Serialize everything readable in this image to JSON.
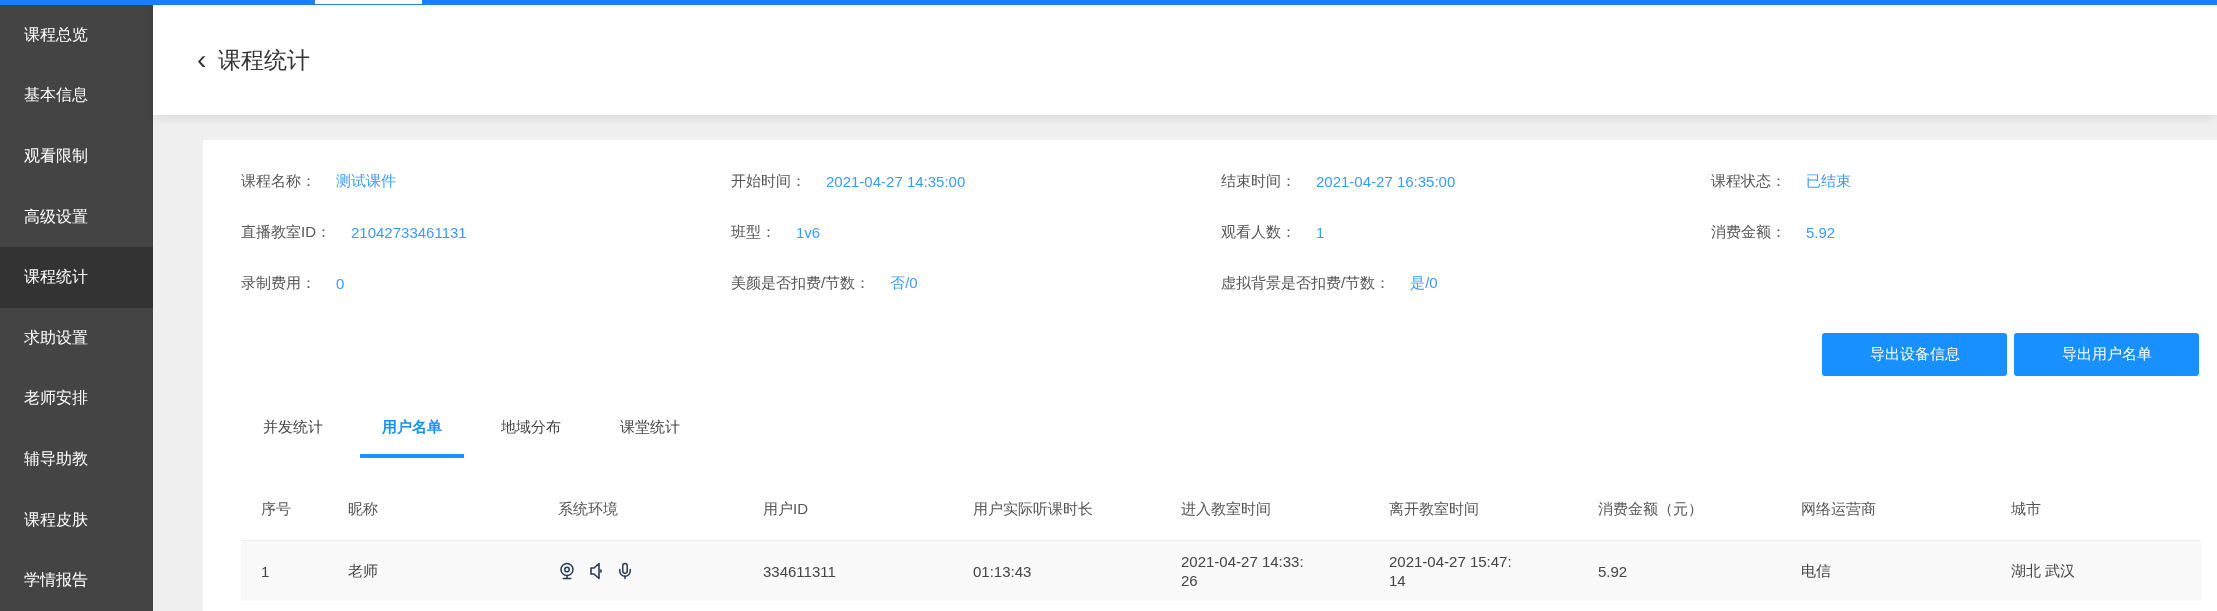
{
  "sidebar": {
    "items": [
      {
        "label": "课程总览",
        "selected": false
      },
      {
        "label": "基本信息",
        "selected": false
      },
      {
        "label": "观看限制",
        "selected": false
      },
      {
        "label": "高级设置",
        "selected": false
      },
      {
        "label": "课程统计",
        "selected": true
      },
      {
        "label": "求助设置",
        "selected": false
      },
      {
        "label": "老师安排",
        "selected": false
      },
      {
        "label": "辅导助教",
        "selected": false
      },
      {
        "label": "课程皮肤",
        "selected": false
      },
      {
        "label": "学情报告",
        "selected": false
      }
    ]
  },
  "header": {
    "back": "‹",
    "title": "课程统计"
  },
  "info": [
    {
      "label": "课程名称：",
      "value": "测试课件"
    },
    {
      "label": "开始时间：",
      "value": "2021-04-27 14:35:00"
    },
    {
      "label": "结束时间：",
      "value": "2021-04-27 16:35:00"
    },
    {
      "label": "课程状态：",
      "value": "已结束"
    },
    {
      "label": "直播教室ID：",
      "value": "21042733461131"
    },
    {
      "label": "班型：",
      "value": "1v6"
    },
    {
      "label": "观看人数：",
      "value": "1"
    },
    {
      "label": "消费金额：",
      "value": "5.92"
    },
    {
      "label": "录制费用：",
      "value": "0"
    },
    {
      "label": "美颜是否扣费/节数：",
      "value": "否/0"
    },
    {
      "label": "虚拟背景是否扣费/节数：",
      "value": "是/0"
    }
  ],
  "buttons": [
    "导出设备信息",
    "导出用户名单"
  ],
  "tabs": [
    {
      "label": "并发统计",
      "selected": false
    },
    {
      "label": "用户名单",
      "selected": true
    },
    {
      "label": "地域分布",
      "selected": false
    },
    {
      "label": "课堂统计",
      "selected": false
    }
  ],
  "table": {
    "columns": [
      "序号",
      "昵称",
      "系统环境",
      "用户ID",
      "用户实际听课时长",
      "进入教室时间",
      "离开教室时间",
      "消费金额（元）",
      "网络运营商",
      "城市"
    ],
    "rows": [
      {
        "cells": [
          "1",
          "老师",
          "",
          "334611311",
          "01:13:43",
          "2021-04-27 14:33:26",
          "2021-04-27 15:47:14",
          "5.92",
          "电信",
          "湖北 武汉"
        ]
      }
    ]
  }
}
